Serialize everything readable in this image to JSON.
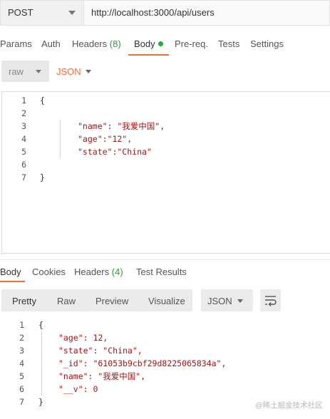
{
  "request": {
    "method": "POST",
    "url": "http://localhost:3000/api/users",
    "tabs": [
      {
        "label": "Params"
      },
      {
        "label": "Auth"
      },
      {
        "label": "Headers",
        "count": "(8)"
      },
      {
        "label": "Body"
      },
      {
        "label": "Pre-req."
      },
      {
        "label": "Tests"
      },
      {
        "label": "Settings"
      }
    ],
    "body_mode": "raw",
    "body_language": "JSON",
    "line_numbers": [
      "1",
      "2",
      "3",
      "4",
      "5",
      "6",
      "7"
    ],
    "code_lines": [
      "{",
      "",
      "\"name\": \"我爱中国\",",
      "\"age\":\"12\",",
      "\"state\":\"China\"",
      "",
      "}"
    ]
  },
  "response": {
    "tabs": [
      {
        "label": "Body"
      },
      {
        "label": "Cookies"
      },
      {
        "label": "Headers",
        "count": "(4)"
      },
      {
        "label": "Test Results"
      }
    ],
    "views": [
      "Pretty",
      "Raw",
      "Preview",
      "Visualize"
    ],
    "format": "JSON",
    "line_numbers": [
      "1",
      "2",
      "3",
      "4",
      "5",
      "6",
      "7"
    ],
    "code_lines": [
      "{",
      "\"age\": 12,",
      "\"state\": \"China\",",
      "\"_id\": \"61053b9cbf29d8225065834a\",",
      "\"name\": \"我爱中国\",",
      "\"__v\": 0",
      "}"
    ]
  },
  "watermark": "@稀土掘金技术社区",
  "colors": {
    "accent": "#f26b3a",
    "status_green": "#2ca548"
  }
}
